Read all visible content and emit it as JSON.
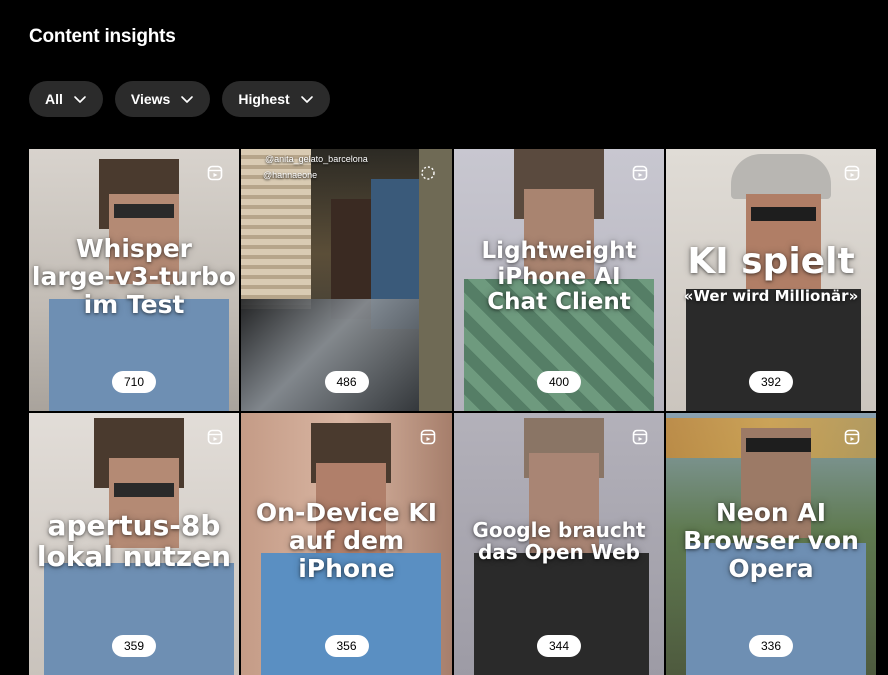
{
  "header": {
    "title": "Content insights"
  },
  "filters": [
    {
      "label": "All"
    },
    {
      "label": "Views"
    },
    {
      "label": "Highest"
    }
  ],
  "tiles": [
    {
      "text": "Whisper\nlarge-v3-turbo\nim Test",
      "sub": "",
      "count": "710",
      "icon": "reel-icon",
      "bg": "#c9c3bc",
      "shirt": "#6e8fb3"
    },
    {
      "text": "",
      "sub": "",
      "count": "486",
      "icon": "loading-icon",
      "bg": "#4b3f2c",
      "shirt": "#3a5a7a",
      "tags": [
        "@anita_gelato_barcelona",
        "@hannaeone"
      ]
    },
    {
      "text": "Lightweight\niPhone AI\nChat Client",
      "sub": "",
      "count": "400",
      "icon": "reel-icon",
      "bg": "#b9b8c2",
      "shirt": "#5e8a6e"
    },
    {
      "text": "KI spielt",
      "sub": "«Wer wird Millionär»",
      "count": "392",
      "icon": "reel-icon",
      "bg": "#cfc9c2",
      "shirt": "#2a2a2a"
    },
    {
      "text": "apertus-8b\nlokal nutzen",
      "sub": "",
      "count": "359",
      "icon": "reel-icon",
      "bg": "#d6d0cb",
      "shirt": "#6e8fb3"
    },
    {
      "text": "On-Device KI\nauf dem\niPhone",
      "sub": "",
      "count": "356",
      "icon": "reel-icon",
      "bg": "#c79f8a",
      "shirt": "#5a8fc2"
    },
    {
      "text": "Google braucht\ndas Open Web",
      "sub": "",
      "count": "344",
      "icon": "reel-icon",
      "bg": "#a5a3ae",
      "shirt": "#2a2a2a"
    },
    {
      "text": "Neon AI\nBrowser von\nOpera",
      "sub": "",
      "count": "336",
      "icon": "reel-icon",
      "bg": "#6f7a5c",
      "shirt": "#6e8fb3"
    }
  ]
}
